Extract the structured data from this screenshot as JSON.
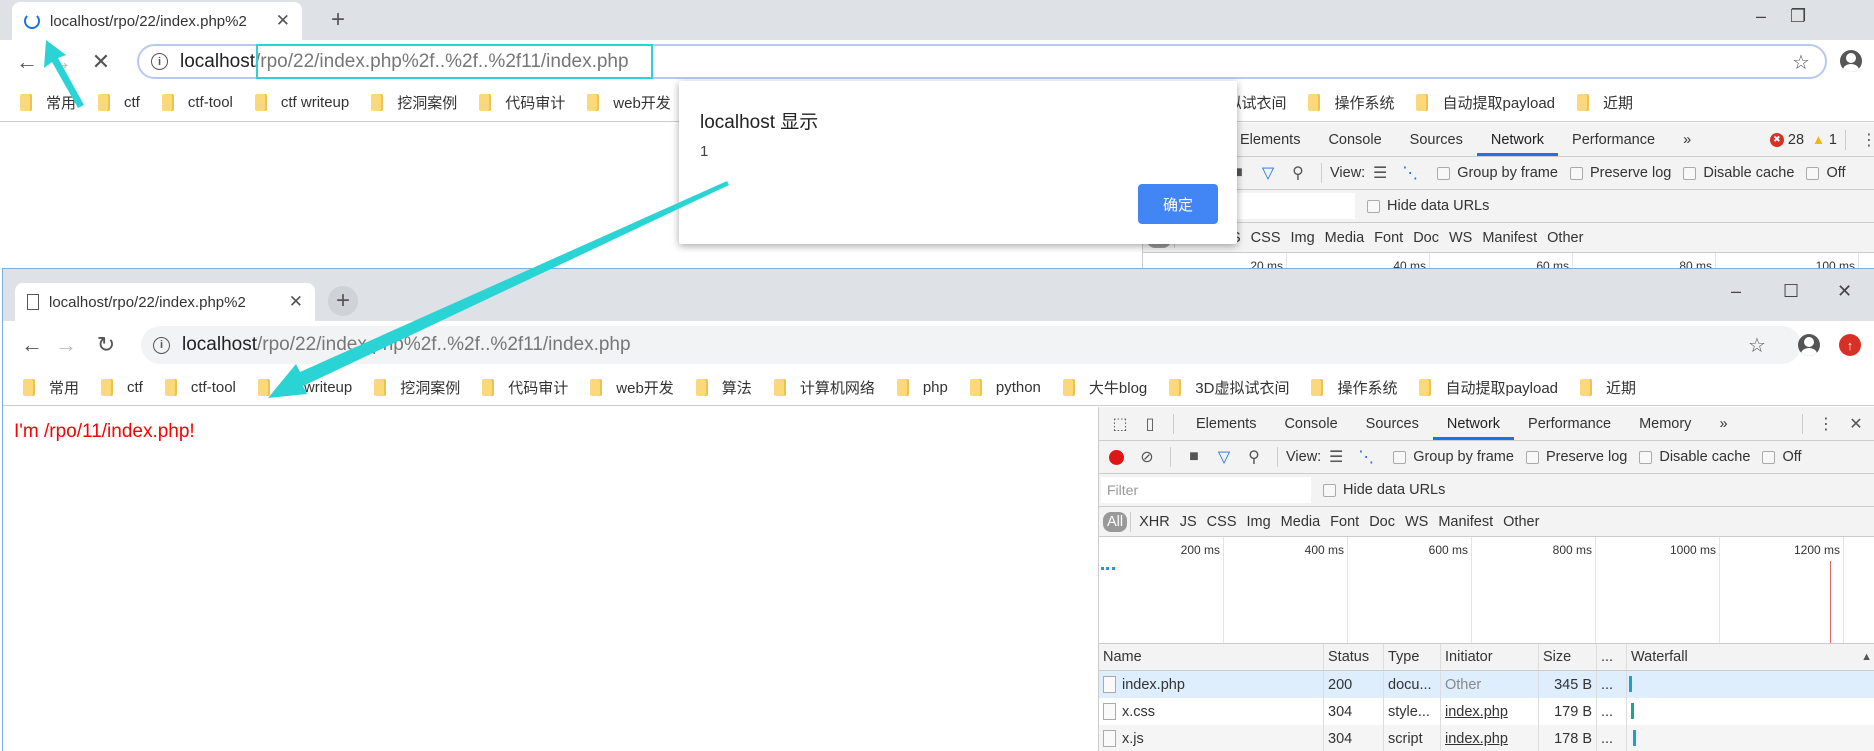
{
  "colors": {
    "accent": "#1a73e8",
    "annotation": "#2ad4d4",
    "page_text": "#ff0000",
    "dialog_button": "#4285f4"
  },
  "top_window": {
    "tab_title": "localhost/rpo/22/index.php%2",
    "tab_icon": "loading-spinner-icon",
    "url_host": "localhost",
    "url_path": "/rpo/22/index.php%2f..%2f..%2f11/index.php",
    "devtools": {
      "tabs": [
        "Elements",
        "Console",
        "Sources",
        "Network",
        "Performance"
      ],
      "active_tab": "Network",
      "error_count": "28",
      "warning_count": "1",
      "timeline_ticks": [
        "20 ms",
        "40 ms",
        "60 ms",
        "80 ms",
        "100 ms"
      ]
    }
  },
  "dialog": {
    "title": "localhost 显示",
    "message": "1",
    "ok_label": "确定"
  },
  "bottom_window": {
    "tab_title": "localhost/rpo/22/index.php%2",
    "tab_icon": "page-icon",
    "url_host": "localhost",
    "url_path": "/rpo/22/index.php%2f..%2f..%2f11/index.php",
    "page_text": "I'm /rpo/11/index.php!",
    "devtools": {
      "tabs": [
        "Elements",
        "Console",
        "Sources",
        "Network",
        "Performance",
        "Memory"
      ],
      "active_tab": "Network",
      "timeline_ticks": [
        "200 ms",
        "400 ms",
        "600 ms",
        "800 ms",
        "1000 ms",
        "1200 ms"
      ],
      "columns": [
        "Name",
        "Status",
        "Type",
        "Initiator",
        "Size",
        "...",
        "Waterfall"
      ],
      "rows": [
        {
          "name": "index.php",
          "status": "200",
          "type": "docu...",
          "initiator": "Other",
          "size": "345 B",
          "more": "..."
        },
        {
          "name": "x.css",
          "status": "304",
          "type": "style...",
          "initiator": "index.php",
          "size": "179 B",
          "more": "..."
        },
        {
          "name": "x.js",
          "status": "304",
          "type": "script",
          "initiator": "index.php",
          "size": "178 B",
          "more": "..."
        }
      ]
    }
  },
  "devtools_common": {
    "view_label": "View:",
    "group_by_frame": "Group by frame",
    "preserve_log": "Preserve log",
    "disable_cache": "Disable cache",
    "offline": "Off",
    "filter_placeholder": "Filter",
    "hide_data_urls": "Hide data URLs",
    "types": [
      "All",
      "XHR",
      "JS",
      "CSS",
      "Img",
      "Media",
      "Font",
      "Doc",
      "WS",
      "Manifest",
      "Other"
    ],
    "more_tabs": "»"
  },
  "bookmarks": [
    "常用",
    "ctf",
    "ctf-tool",
    "ctf writeup",
    "挖洞案例",
    "代码审计",
    "web开发",
    "算法",
    "计算机网络",
    "php",
    "python",
    "大牛blog",
    "3D虚拟试衣间",
    "操作系统",
    "自动提取payload",
    "近期"
  ]
}
